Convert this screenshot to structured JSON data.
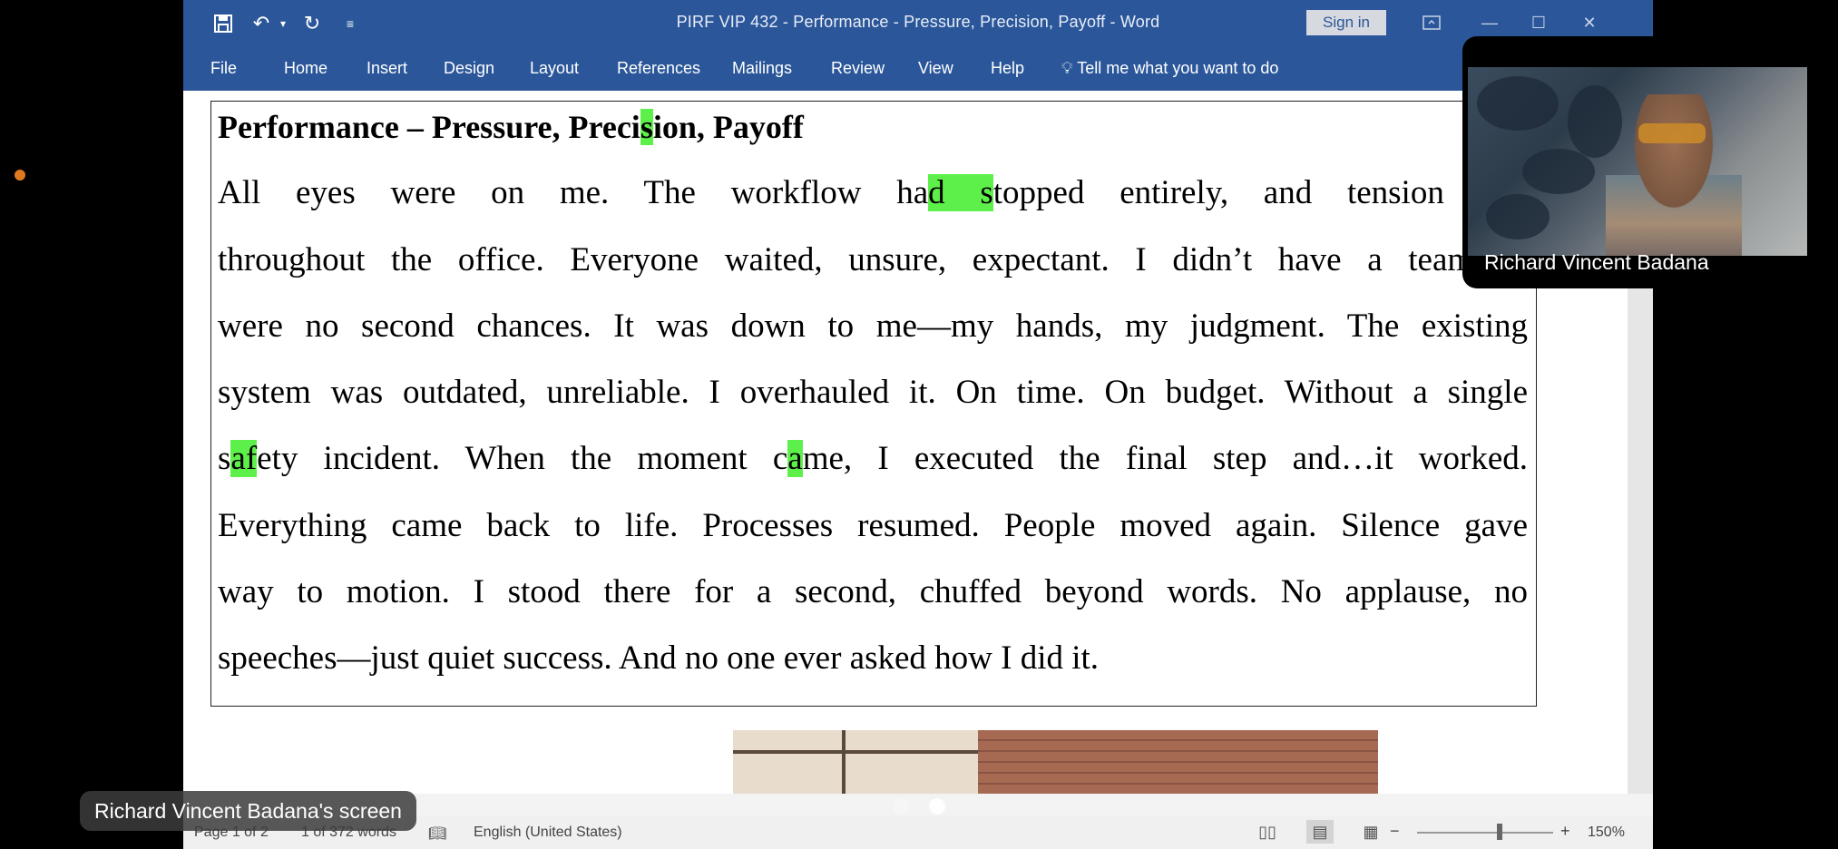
{
  "window": {
    "title": "PIRF VIP 432 - Performance - Pressure, Precision, Payoff  -  Word",
    "sign_in": "Sign in"
  },
  "quick_access": [
    "save-icon",
    "undo-icon",
    "redo-icon",
    "customize-icon"
  ],
  "ribbon": {
    "tabs": [
      "File",
      "Home",
      "Insert",
      "Design",
      "Layout",
      "References",
      "Mailings",
      "Review",
      "View",
      "Help"
    ],
    "tell_me": "Tell me what you want to do"
  },
  "document": {
    "heading": {
      "pre": "Performance – Pressure, Preci",
      "hl": "s",
      "post": "ion, Payoff"
    },
    "lines": [
      {
        "pre": "All eyes were on me. The workflow ha",
        "hl": "d s",
        "post": "topped entirely, and tension buz"
      },
      {
        "pre": "throughout the office. Everyone waited, unsure, expectant. I didn’t have a team. T",
        "hl": "",
        "post": ""
      },
      {
        "pre": "were no second chances. It was down to me—my hands, my judgment. The existing",
        "hl": "",
        "post": ""
      },
      {
        "pre": "system was outdated, unreliable. I overhauled it. On time. On budget. Without a single",
        "hl": "",
        "post": ""
      },
      {
        "pre": "s",
        "hl": "af",
        "post": "ety incident. When the moment c",
        "hl2": "a",
        "post2": "me, I executed the final step and…it worked."
      },
      {
        "pre": "Everything came back to life. Processes resumed. People moved again. Silence gave",
        "hl": "",
        "post": ""
      },
      {
        "pre": "way to motion. I stood there for a second, chuffed beyond words. No applause, no",
        "hl": "",
        "post": ""
      },
      {
        "pre": "speeches—just quiet success. And no one ever asked how I did it.",
        "hl": "",
        "post": ""
      }
    ]
  },
  "statusbar": {
    "page": "Page 1 of 2",
    "words": "1 of 372 words",
    "language": "English (United States)",
    "zoom": "150%",
    "zoom_minus": "−",
    "zoom_plus": "+"
  },
  "call": {
    "participant_name": "Richard Vincent Badana",
    "screen_label": "Richard Vincent Badana's screen"
  },
  "colors": {
    "ribbon": "#2b579a",
    "highlight": "#5ef04a",
    "indicator_dot": "#e07a1f"
  }
}
